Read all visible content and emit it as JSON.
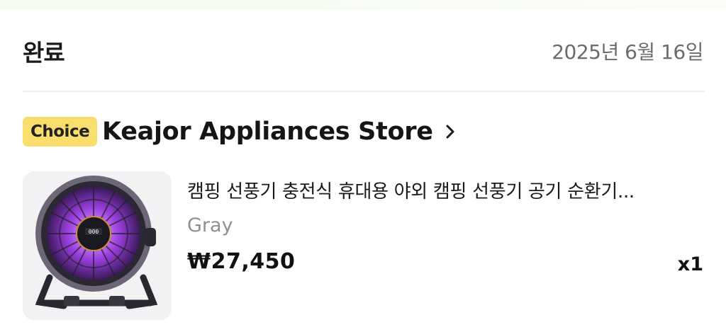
{
  "order": {
    "status": "완료",
    "date": "2025년 6월 16일"
  },
  "store": {
    "badge": "Choice",
    "name": "Keajor Appliances Store",
    "badge_color": "#f9de6e"
  },
  "product": {
    "title": "캠핑 선풍기 충전식 휴대용 야외 캠핑 선풍기 공기 순환기...",
    "variant": "Gray",
    "price": "₩27,450",
    "quantity": "x1",
    "image_icon": "fan-product-image"
  }
}
